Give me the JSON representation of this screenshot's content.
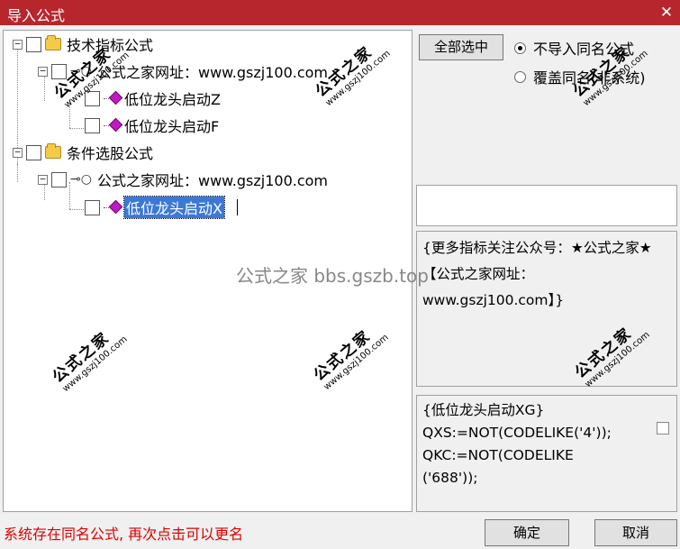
{
  "window": {
    "title": "导入公式",
    "close_glyph": "✕"
  },
  "tree": {
    "group1": {
      "label": "技术指标公式"
    },
    "group1_sub": {
      "label": "公式之家网址：www.gszj100.com"
    },
    "group1_items": [
      {
        "label": "低位龙头启动Z"
      },
      {
        "label": "低位龙头启动F"
      }
    ],
    "group2": {
      "label": "条件选股公式"
    },
    "group2_sub": {
      "label": "公式之家网址：www.gszj100.com"
    },
    "group2_items": [
      {
        "label": "低位龙头启动X"
      }
    ]
  },
  "options": {
    "select_all_label": "全部选中",
    "radio_no_import": "不导入同名公式",
    "radio_overwrite": "覆盖同名(非系统)"
  },
  "description": "{更多指标关注公众号：★公式之家★ 【公式之家网址：www.gszj100.com】}",
  "code": {
    "line1": "{低位龙头启动XG}",
    "line2": "QXS:=NOT(CODELIKE('4'));",
    "line3": "QKC:=NOT(CODELIKE",
    "line4": "('688'));"
  },
  "status_message": "系统存在同名公式, 再次点击可以更名",
  "buttons": {
    "ok": "确定",
    "cancel": "取消"
  },
  "watermark": {
    "brand": "公式之家",
    "url": "www.gszj100.com",
    "center": "公式之家 bbs.gszb.top"
  },
  "colors": {
    "titlebar": "#b8262d",
    "selection": "#3b78d8",
    "status_text": "#e00000"
  }
}
